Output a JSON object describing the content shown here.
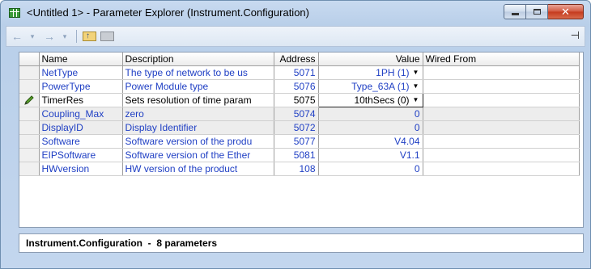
{
  "window": {
    "title": "<Untitled 1> - Parameter Explorer (Instrument.Configuration)",
    "close_glyph": "✕"
  },
  "toolbar": {
    "back_icon": "←",
    "back_dropdown_icon": "▾",
    "forward_icon": "→",
    "forward_dropdown_icon": "▾",
    "pin_icon": "⊣"
  },
  "table": {
    "columns": [
      "Name",
      "Description",
      "Address",
      "Value",
      "Wired From"
    ],
    "rows": [
      {
        "name": "NetType",
        "description": "The type of network to be us",
        "address": "5071",
        "value": "1PH (1)",
        "dropdown": true,
        "editable_name": false
      },
      {
        "name": "PowerType",
        "description": "Power Module type",
        "address": "5076",
        "value": "Type_63A (1)",
        "dropdown": true,
        "editable_name": false
      },
      {
        "name": "TimerRes",
        "description": "Sets resolution of time param",
        "address": "5075",
        "value": "10thSecs (0)",
        "dropdown": true,
        "editable_name": true
      },
      {
        "name": "Coupling_Max",
        "description": "zero",
        "address": "5074",
        "value": "0",
        "dropdown": false,
        "editable_name": false
      },
      {
        "name": "DisplayID",
        "description": "Display Identifier",
        "address": "5072",
        "value": "0",
        "dropdown": false,
        "editable_name": false
      },
      {
        "name": "Software",
        "description": "Software version of the produ",
        "address": "5077",
        "value": "V4.04",
        "dropdown": false,
        "editable_name": false
      },
      {
        "name": "EIPSoftware",
        "description": "Software version of the Ether",
        "address": "5081",
        "value": "V1.1",
        "dropdown": false,
        "editable_name": false
      },
      {
        "name": "HWversion",
        "description": "HW version of the product",
        "address": "108",
        "value": "0",
        "dropdown": false,
        "editable_name": false
      }
    ],
    "dropdown_icon": "▼"
  },
  "status": {
    "text": "Instrument.Configuration  -  8 parameters"
  }
}
